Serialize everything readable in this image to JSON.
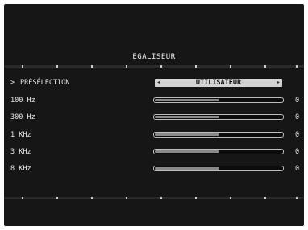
{
  "menu": {
    "title": "EGALISEUR",
    "preset": {
      "cursor": ">",
      "label": "PRÉSÉLECTION",
      "value": "UTILISATEUR",
      "left_icon": "triangle-left-icon",
      "right_icon": "triangle-right-icon"
    },
    "bands": [
      {
        "label": "100 Hz",
        "value": "0",
        "level": 0.5
      },
      {
        "label": "300 Hz",
        "value": "0",
        "level": 0.5
      },
      {
        "label": "1 KHz",
        "value": "0",
        "level": 0.5
      },
      {
        "label": "3 KHz",
        "value": "0",
        "level": 0.5
      },
      {
        "label": "8 KHz",
        "value": "0",
        "level": 0.5
      }
    ]
  },
  "colors": {
    "panel_background": "#161616",
    "text": "#e8e8e8",
    "selector_background": "#d2d2d2",
    "slider_fill": "#8a8a8a"
  }
}
